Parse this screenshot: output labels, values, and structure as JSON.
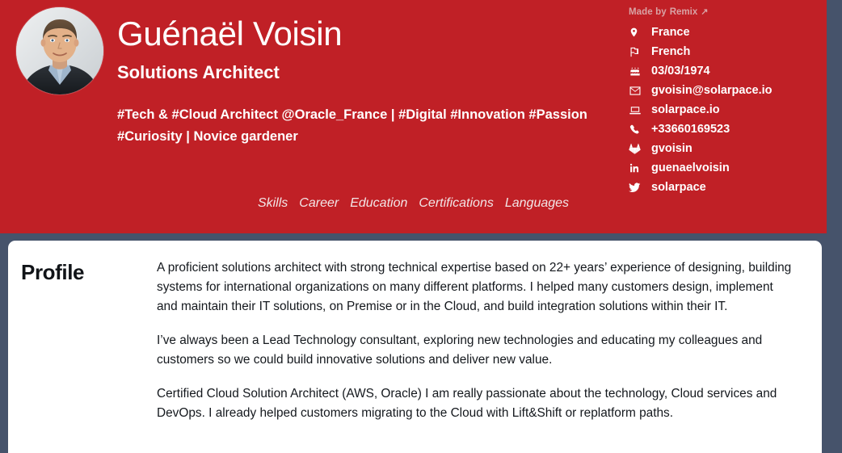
{
  "theme": {
    "header_red": "#c02026",
    "page_background": "#46536b",
    "card_background": "#ffffff",
    "header_text": "#ffffff",
    "muted_header_text": "#d9a3a5",
    "body_text": "#14181d"
  },
  "header": {
    "name": "Guénaël Voisin",
    "role": "Solutions Architect",
    "bio": "#Tech & #Cloud Architect @Oracle_France | #Digital #Innovation #Passion #Curiosity | Novice gardener",
    "avatar_alt": "Portrait photo of Guénaël Voisin"
  },
  "made_by": {
    "prefix": "Made by",
    "brand": "Remix",
    "arrow": "↗"
  },
  "nav": {
    "items": [
      {
        "label": "Skills"
      },
      {
        "label": "Career"
      },
      {
        "label": "Education"
      },
      {
        "label": "Certifications"
      },
      {
        "label": "Languages"
      }
    ]
  },
  "contact": {
    "items": [
      {
        "icon": "map-pin-icon",
        "name": "contact-location",
        "value": "France"
      },
      {
        "icon": "flag-icon",
        "name": "contact-language",
        "value": "French"
      },
      {
        "icon": "birthday-cake-icon",
        "name": "contact-birthdate",
        "value": "03/03/1974"
      },
      {
        "icon": "envelope-icon",
        "name": "contact-email",
        "value": "gvoisin@solarpace.io"
      },
      {
        "icon": "laptop-icon",
        "name": "contact-website",
        "value": "solarpace.io"
      },
      {
        "icon": "phone-icon",
        "name": "contact-phone",
        "value": "+33660169523"
      },
      {
        "icon": "gitlab-icon",
        "name": "contact-gitlab",
        "value": "gvoisin"
      },
      {
        "icon": "linkedin-icon",
        "name": "contact-linkedin",
        "value": "guenaelvoisin"
      },
      {
        "icon": "twitter-icon",
        "name": "contact-twitter",
        "value": "solarpace"
      }
    ]
  },
  "profile": {
    "title": "Profile",
    "paragraphs": [
      "A proficient solutions architect with strong technical expertise based on 22+ years’ experience of designing, building systems for international organizations on many different platforms. I helped many customers design, implement and maintain their IT solutions, on Premise or in the Cloud, and build integration solutions within their IT.",
      "I’ve always been a Lead Technology consultant, exploring new technologies and educating my colleagues and customers so we could build innovative solutions and deliver new value.",
      "Certified Cloud Solution Architect (AWS, Oracle) I am really passionate about the technology, Cloud services and DevOps. I already helped customers migrating to the Cloud with Lift&Shift or replatform paths."
    ]
  }
}
